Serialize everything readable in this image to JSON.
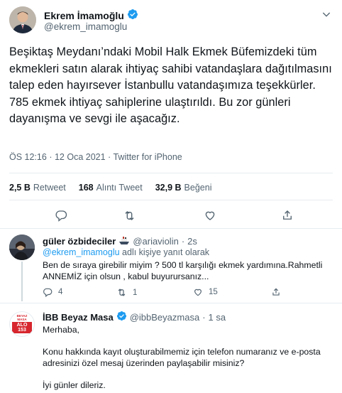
{
  "main_tweet": {
    "author_name": "Ekrem İmamoğlu",
    "author_handle": "@ekrem_imamoglu",
    "text": "Beşiktaş Meydanı’ndaki Mobil Halk Ekmek Büfemizdeki tüm ekmekleri satın alarak ihtiyaç sahibi vatandaşlara dağıtılmasını talep eden hayırsever İstanbullu vatandaşımıza teşekkürler. 785 ekmek ihtiyaç sahiplerine ulaştırıldı. Bu zor günleri dayanışma ve sevgi ile aşacağız.",
    "time": "ÖS 12:16",
    "date": "12 Oca 2021",
    "source": "Twitter for iPhone",
    "meta_separator": "·",
    "stats": {
      "retweets_count": "2,5 B",
      "retweets_label": "Retweet",
      "quotes_count": "168",
      "quotes_label": "Alıntı Tweet",
      "likes_count": "32,9 B",
      "likes_label": "Beğeni"
    }
  },
  "replies": [
    {
      "author_name": "güler özbideciler",
      "author_handle": "@ariaviolin",
      "separator": "·",
      "time": "2s",
      "replying_mention": "@ekrem_imamoglu",
      "replying_suffix": "adlı kişiye yanıt olarak",
      "text_line1": "Ben de sıraya girebilir miyim ? 500 tl karşılığı ekmek yardımına.Rahmetli",
      "text_line2": "ANNEMİZ için olsun , kabul buyurursanız...",
      "reply_count": "4",
      "retweet_count": "1",
      "like_count": "15"
    },
    {
      "author_name": "İBB Beyaz Masa",
      "author_handle": "@ibbBeyazmasa",
      "separator": "·",
      "time": "1 sa",
      "avatar_text": "ALO 153",
      "avatar_small_text": "BEYAZ MASA",
      "para1": "Merhaba,",
      "para2_line1": "Konu hakkında kayıt oluşturabilmemiz için telefon numaranız ve e-posta",
      "para2_line2": "adresinizi özel mesaj üzerinden paylaşabilir misiniz?",
      "para3": "İyi günler dileriz."
    }
  ],
  "icons": {
    "verified": "verified-badge-icon",
    "more": "chevron-down-icon",
    "reply": "reply-icon",
    "retweet": "retweet-icon",
    "like": "heart-icon",
    "share": "share-icon",
    "flag_emoji": "ship-emoji-icon"
  },
  "colors": {
    "accent": "#1d9bf0",
    "text_secondary": "#536471",
    "divider": "#e6ecf0",
    "ibb_red": "#d7262e"
  }
}
